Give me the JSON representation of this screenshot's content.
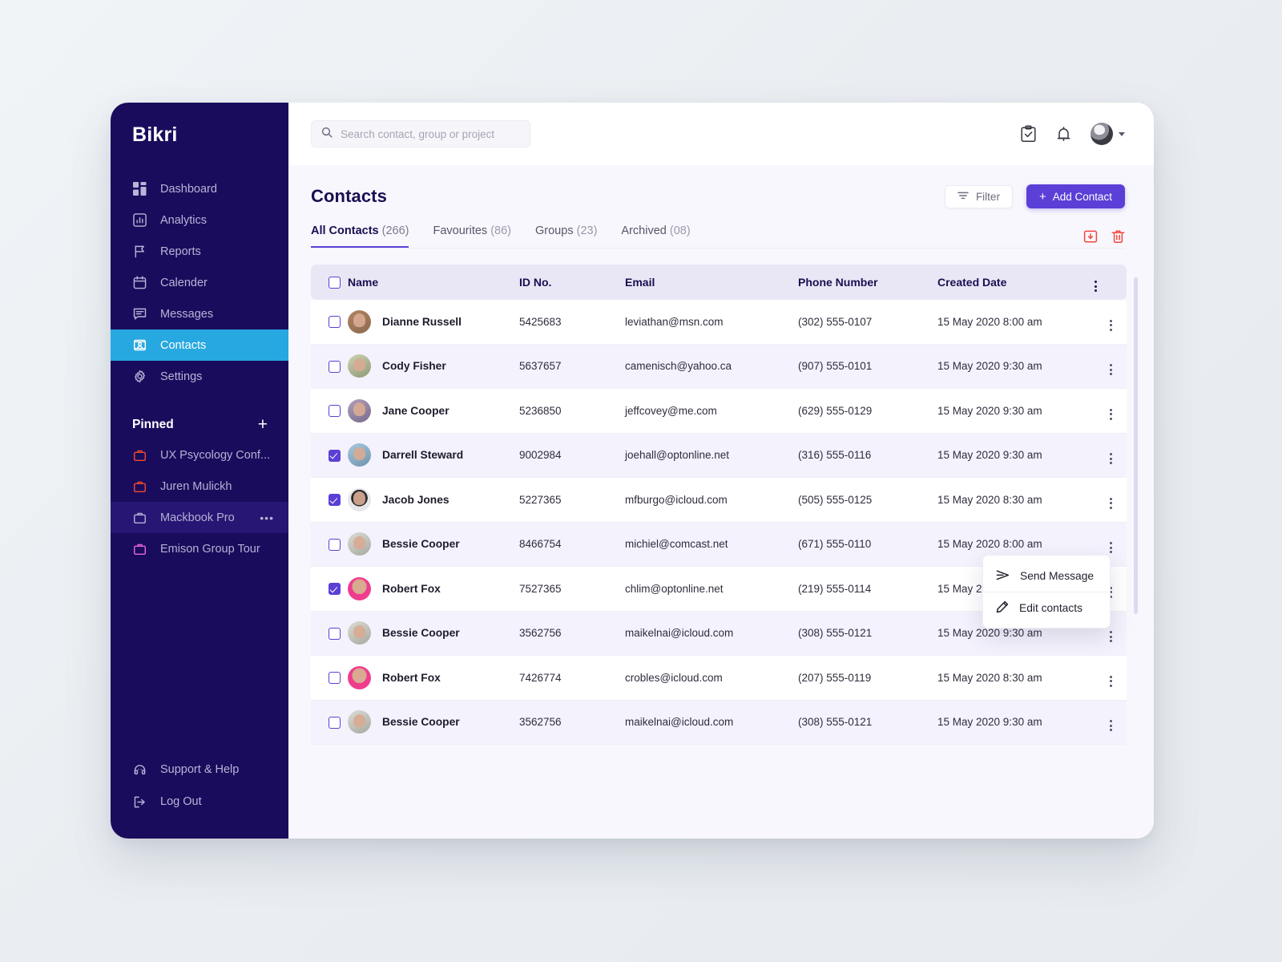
{
  "app": {
    "brand": "Bikri"
  },
  "sidebar": {
    "nav": [
      {
        "label": "Dashboard",
        "icon": "dashboard-icon",
        "active": false
      },
      {
        "label": "Analytics",
        "icon": "analytics-icon",
        "active": false
      },
      {
        "label": "Reports",
        "icon": "flag-icon",
        "active": false
      },
      {
        "label": "Calender",
        "icon": "calendar-icon",
        "active": false
      },
      {
        "label": "Messages",
        "icon": "message-icon",
        "active": false
      },
      {
        "label": "Contacts",
        "icon": "contacts-card-icon",
        "active": true
      },
      {
        "label": "Settings",
        "icon": "gear-icon",
        "active": false
      }
    ],
    "pinned_title": "Pinned",
    "pinned_add": "+",
    "pinned": [
      {
        "label": "UX Psycology Conf...",
        "icon": "briefcase-icon",
        "color": "#f04a2e",
        "selected": false,
        "dots": ""
      },
      {
        "label": "Juren Mulickh",
        "icon": "briefcase-icon",
        "color": "#f04a2e",
        "selected": false,
        "dots": ""
      },
      {
        "label": "Mackbook Pro",
        "icon": "briefcase-icon",
        "color": "#b6b0d8",
        "selected": true,
        "dots": "•••"
      },
      {
        "label": "Emison Group Tour",
        "icon": "briefcase-icon",
        "color": "#e864e0",
        "selected": false,
        "dots": ""
      }
    ],
    "bottom": [
      {
        "label": "Support & Help",
        "icon": "support-icon"
      },
      {
        "label": "Log Out",
        "icon": "logout-icon"
      }
    ]
  },
  "topbar": {
    "search_placeholder": "Search contact, group or project",
    "search_value": "",
    "icons": [
      "tasks-clipboard-icon",
      "bell-icon",
      "avatar",
      "chevron-down-icon"
    ]
  },
  "page": {
    "title": "Contacts",
    "filter_label": "Filter",
    "add_label": "Add Contact",
    "add_plus": "+"
  },
  "tabs": [
    {
      "label": "All Contacts",
      "count": "(266)",
      "active": true
    },
    {
      "label": "Favourites",
      "count": "(86)",
      "active": false
    },
    {
      "label": "Groups",
      "count": "(23)",
      "active": false
    },
    {
      "label": "Archived",
      "count": "(08)",
      "active": false
    }
  ],
  "tab_tools": [
    {
      "name": "archive-download-icon",
      "color": "#f2463a"
    },
    {
      "name": "delete-trash-icon",
      "color": "#f2463a"
    }
  ],
  "table": {
    "columns": [
      "Name",
      "ID No.",
      "Email",
      "Phone Number",
      "Created Date"
    ],
    "header_checkbox_checked": false,
    "rows": [
      {
        "checked": false,
        "name": "Dianne Russell",
        "id": "5425683",
        "email": "leviathan@msn.com",
        "phone": "(302) 555-0107",
        "date": "15 May 2020 8:00 am",
        "avatar": "#c9a07a"
      },
      {
        "checked": false,
        "name": "Cody Fisher",
        "id": "5637657",
        "email": "camenisch@yahoo.ca",
        "phone": "(907) 555-0101",
        "date": "15 May 2020 9:30 am",
        "avatar": "#b9c6a8"
      },
      {
        "checked": false,
        "name": "Jane Cooper",
        "id": "5236850",
        "email": "jeffcovey@me.com",
        "phone": "(629) 555-0129",
        "date": "15 May 2020 9:30 am",
        "avatar": "#9c8fae"
      },
      {
        "checked": true,
        "name": "Darrell Steward",
        "id": "9002984",
        "email": "joehall@optonline.net",
        "phone": "(316) 555-0116",
        "date": "15 May 2020 9:30 am",
        "avatar": "#8fb5cf"
      },
      {
        "checked": true,
        "name": "Jacob Jones",
        "id": "5227365",
        "email": "mfburgo@icloud.com",
        "phone": "(505) 555-0125",
        "date": "15 May 2020 8:30 am",
        "avatar": "#e6e6e8"
      },
      {
        "checked": false,
        "name": "Bessie Cooper",
        "id": "8466754",
        "email": "michiel@comcast.net",
        "phone": "(671) 555-0110",
        "date": "15 May 2020 8:00 am",
        "avatar": "#cdd2cc"
      },
      {
        "checked": true,
        "name": "Robert Fox",
        "id": "7527365",
        "email": "chlim@optonline.net",
        "phone": "(219) 555-0114",
        "date": "15 May 2020 8:30 am",
        "avatar": "#ef3d8e"
      },
      {
        "checked": false,
        "name": "Bessie Cooper",
        "id": "3562756",
        "email": "maikelnai@icloud.com",
        "phone": "(308) 555-0121",
        "date": "15 May 2020 9:30 am",
        "avatar": "#cdd2cc"
      },
      {
        "checked": false,
        "name": "Robert Fox",
        "id": "7426774",
        "email": "crobles@icloud.com",
        "phone": "(207) 555-0119",
        "date": "15 May 2020 8:30 am",
        "avatar": "#ef3d8e"
      },
      {
        "checked": false,
        "name": "Bessie Cooper",
        "id": "3562756",
        "email": "maikelnai@icloud.com",
        "phone": "(308) 555-0121",
        "date": "15 May 2020 9:30 am",
        "avatar": "#cdd2cc"
      }
    ]
  },
  "context_menu": {
    "items": [
      {
        "label": "Send Message",
        "icon": "send-arrow-icon"
      },
      {
        "label": "Edit contacts",
        "icon": "pencil-edit-icon"
      }
    ]
  },
  "colors": {
    "sidebar_bg": "#1a0c5c",
    "active_nav": "#27a8e0",
    "accent_purple": "#5b3fd6",
    "danger_red": "#f2463a",
    "row_alt": "#f4f2fc",
    "header_row": "#e9e7f5"
  }
}
